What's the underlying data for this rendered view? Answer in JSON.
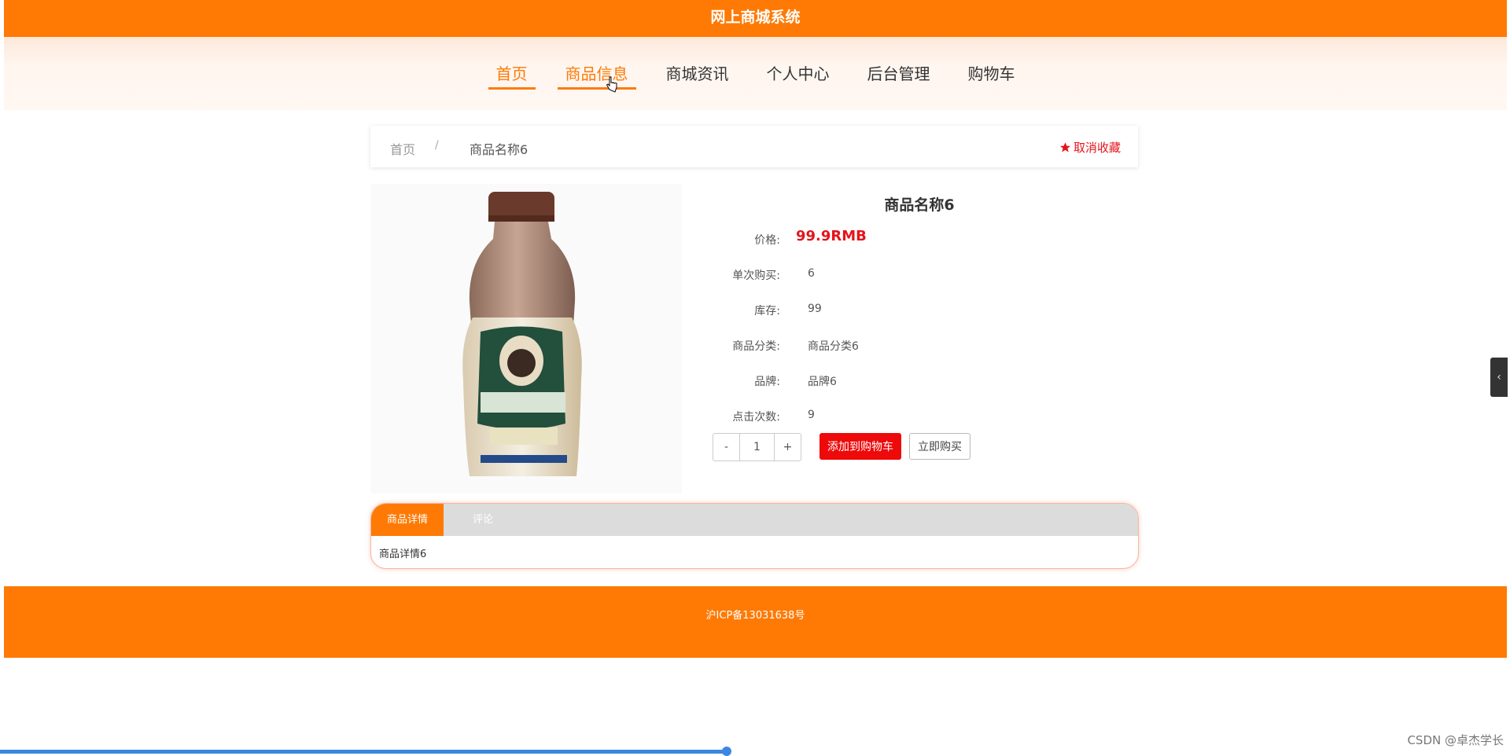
{
  "app": {
    "title": "网上商城系统"
  },
  "nav": [
    "首页",
    "商品信息",
    "商城资讯",
    "个人中心",
    "后台管理",
    "购物车"
  ],
  "breadcrumb": {
    "home": "首页",
    "separator": "/",
    "current": "商品名称6"
  },
  "favorite": {
    "label": "取消收藏",
    "icon": "star-icon"
  },
  "product": {
    "name": "商品名称6",
    "image_alt": "bottle-of-milk-coffee",
    "fields": [
      {
        "label": "价格:",
        "value": "99.9RMB"
      },
      {
        "label": "单次购买:",
        "value": "6"
      },
      {
        "label": "库存:",
        "value": "99"
      },
      {
        "label": "商品分类:",
        "value": "商品分类6"
      },
      {
        "label": "品牌:",
        "value": "品牌6"
      },
      {
        "label": "点击次数:",
        "value": "9"
      }
    ]
  },
  "stepper": {
    "minus": "-",
    "quantity": "1",
    "plus": "+"
  },
  "actions": {
    "add_to_cart": "添加到购物车",
    "buy_now": "立即购买"
  },
  "tabs": {
    "items": [
      "商品详情",
      "评论"
    ],
    "active_index": 0,
    "content": "商品详情6"
  },
  "footer": {
    "icp": "沪ICP备13031638号"
  },
  "watermark": "CSDN @卓杰学长",
  "colors": {
    "primary": "#fe7a05",
    "price": "#e4141b",
    "cart_button": "#ee0a0a"
  }
}
